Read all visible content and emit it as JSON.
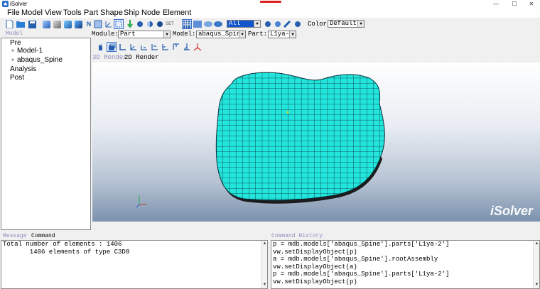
{
  "window": {
    "title": "iSolver",
    "minimize": "—",
    "maximize": "☐",
    "close": "✕"
  },
  "menu": [
    "File",
    "Model",
    "View",
    "Tools",
    "Part",
    "Shape",
    "Ship",
    "Node",
    "Element"
  ],
  "toolbar": {
    "set_label": "SET",
    "filter_value": "All",
    "color_label": "Color:",
    "color_value": "Default"
  },
  "context": {
    "module_label": "Module:",
    "module_value": "Part",
    "model_label": "Model:",
    "model_value": "abaqus_Spine",
    "part_label": "Part:",
    "part_value": "L1ya-2"
  },
  "model_panel": {
    "title": "Model",
    "tree": [
      {
        "label": "Pre",
        "level": 0
      },
      {
        "label": "Model-1",
        "level": 1
      },
      {
        "label": "abaqus_Spine",
        "level": 1
      },
      {
        "label": "Analysis",
        "level": 0
      },
      {
        "label": "Post",
        "level": 0
      }
    ]
  },
  "render_tabs": {
    "tab_3d": "3D Render",
    "tab_2d": "2D Render"
  },
  "viewport": {
    "brand": "iSolver",
    "mesh_color": "#22e5dc",
    "mesh_line": "#0b2f3a"
  },
  "message_panel": {
    "tab_message": "Message",
    "tab_command": "Command",
    "lines": [
      "Total number of elements : 1406",
      "       1406 elements of type C3D8"
    ]
  },
  "history_panel": {
    "title": "Command History",
    "lines": [
      "p = mdb.models['abaqus_Spine'].parts['L1ya-2']",
      "vw.setDisplayObject(p)",
      "a = mdb.models['abaqus_Spine'].rootAssembly",
      "vw.setDisplayObject(a)",
      "p = mdb.models['abaqus_Spine'].parts['L1ya-2']",
      "vw.setDisplayObject(p)"
    ]
  }
}
